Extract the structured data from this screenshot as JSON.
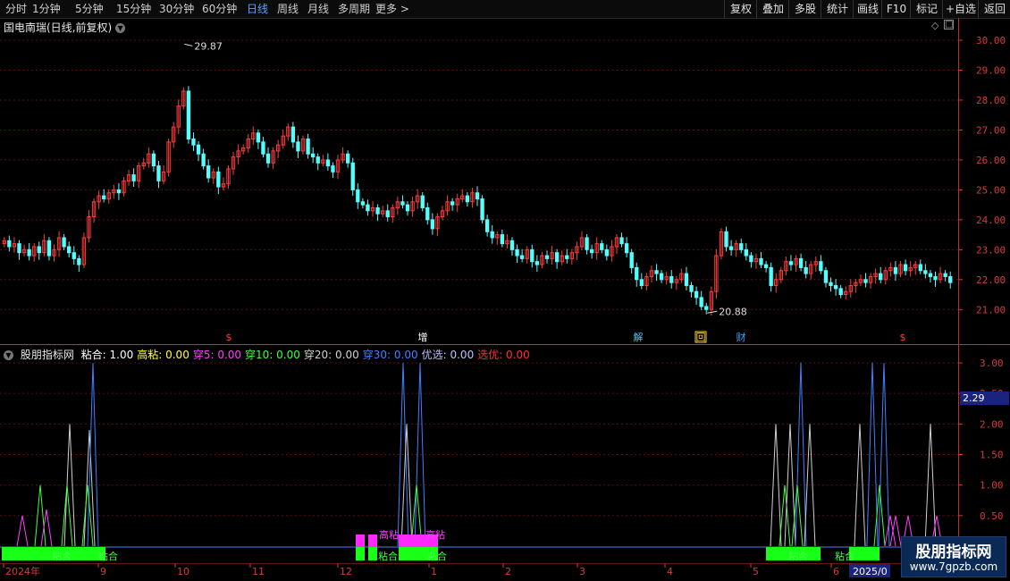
{
  "toolbar": {
    "periods": [
      "分时",
      "1分钟",
      "5分钟",
      "15分钟",
      "30分钟",
      "60分钟",
      "日线",
      "周线",
      "月线",
      "多周期",
      "更多 >"
    ],
    "active": "日线",
    "right_buttons": [
      "复权",
      "叠加",
      "多股",
      "统计",
      "画线",
      "F10",
      "标记",
      "+自选",
      "返回"
    ]
  },
  "main_chart": {
    "title": "国电南瑞(日线,前复权)",
    "high_label": "29.87",
    "low_label": "20.88",
    "y_ticks": [
      "30.00",
      "29.00",
      "28.00",
      "27.00",
      "26.00",
      "25.00",
      "24.00",
      "23.00",
      "22.00",
      "21.00"
    ],
    "events": [
      {
        "text": "$",
        "color": "#ff4040"
      },
      {
        "text": "增",
        "color": "#ffffff"
      },
      {
        "text": "解",
        "color": "#40d0ff"
      },
      {
        "text": "回",
        "color": "#ffd040"
      },
      {
        "text": "财",
        "color": "#40a0ff"
      },
      {
        "text": "$",
        "color": "#ff4040"
      }
    ],
    "colors": {
      "up": "#ff3c3c",
      "down": "#54ffff",
      "grid": "#5a1010"
    },
    "chart_data": {
      "type": "candlestick",
      "y_range": [
        20.5,
        30.3
      ],
      "closes": [
        23.3,
        23.1,
        23.2,
        22.9,
        23.0,
        22.8,
        23.1,
        22.9,
        23.3,
        22.8,
        23.0,
        23.4,
        23.1,
        22.9,
        22.7,
        22.5,
        23.4,
        24.1,
        24.6,
        24.8,
        24.7,
        24.9,
        25.0,
        24.9,
        25.3,
        25.5,
        25.3,
        25.8,
        25.9,
        26.2,
        25.8,
        25.3,
        25.6,
        26.6,
        27.1,
        27.8,
        28.3,
        26.7,
        26.5,
        26.2,
        25.8,
        25.4,
        25.6,
        25.1,
        25.2,
        25.7,
        26.1,
        26.3,
        26.4,
        26.7,
        26.9,
        26.6,
        26.2,
        25.9,
        26.3,
        26.5,
        26.8,
        27.1,
        26.6,
        26.3,
        26.7,
        26.2,
        26.1,
        25.9,
        26.0,
        25.8,
        25.6,
        26.0,
        26.2,
        25.9,
        25.0,
        24.6,
        24.5,
        24.3,
        24.4,
        24.2,
        24.3,
        24.1,
        24.4,
        24.6,
        24.5,
        24.3,
        24.6,
        24.8,
        24.4,
        24.0,
        23.7,
        24.1,
        24.3,
        24.6,
        24.5,
        24.7,
        24.8,
        24.6,
        24.9,
        24.7,
        24.0,
        23.6,
        23.4,
        23.5,
        23.2,
        23.3,
        23.0,
        22.8,
        22.7,
        23.0,
        22.6,
        22.5,
        22.8,
        22.7,
        22.9,
        22.6,
        22.8,
        22.7,
        22.9,
        23.1,
        23.4,
        23.0,
        22.9,
        23.2,
        23.0,
        22.8,
        23.1,
        23.4,
        23.2,
        22.9,
        22.4,
        22.0,
        21.8,
        22.1,
        22.3,
        22.2,
        22.0,
        22.1,
        21.9,
        22.0,
        22.2,
        21.8,
        21.6,
        21.4,
        21.1,
        21.0,
        21.6,
        22.8,
        23.6,
        23.1,
        23.0,
        23.2,
        23.0,
        22.8,
        22.6,
        22.7,
        22.5,
        22.4,
        21.8,
        22.0,
        22.3,
        22.6,
        22.5,
        22.7,
        22.4,
        22.2,
        22.5,
        22.6,
        22.3,
        21.9,
        21.8,
        21.7,
        21.5,
        21.6,
        21.8,
        21.9,
        22.0,
        21.9,
        22.1,
        22.2,
        22.0,
        22.3,
        22.4,
        22.2,
        22.5,
        22.3,
        22.4,
        22.5,
        22.3,
        22.2,
        22.1,
        22.0,
        22.2,
        22.1,
        21.9
      ]
    }
  },
  "indicator": {
    "title": "股朋指标网",
    "legend": [
      {
        "label": "粘合:",
        "value": "1.00",
        "color": "#ffffff"
      },
      {
        "label": "高粘:",
        "value": "0.00",
        "color": "#ffff40"
      },
      {
        "label": "穿5:",
        "value": "0.00",
        "color": "#ff40ff"
      },
      {
        "label": "穿10:",
        "value": "0.00",
        "color": "#40ff40"
      },
      {
        "label": "穿20:",
        "value": "0.00",
        "color": "#d0d0d0"
      },
      {
        "label": "穿30:",
        "value": "0.00",
        "color": "#4080ff"
      },
      {
        "label": "优选:",
        "value": "0.00",
        "color": "#c0c0ff"
      },
      {
        "label": "选优:",
        "value": "0.00",
        "color": "#ff3030"
      }
    ],
    "y_ticks": [
      "3.00",
      "2.50",
      "2.00",
      "1.50",
      "1.00",
      "0.50"
    ],
    "current_value": "2.29",
    "bar_labels": [
      "粘合",
      "粘合",
      "高粘",
      "粘合",
      "高粘",
      "粘合",
      "粘合",
      "粘合",
      "粘合"
    ]
  },
  "x_axis": {
    "labels": [
      "2024年",
      "9",
      "10",
      "11",
      "12",
      "1",
      "2",
      "3",
      "4",
      "5",
      "6",
      "2025/0"
    ]
  },
  "watermark": {
    "line1": "股朋指标网",
    "line2": "www.7gpzb.com"
  }
}
